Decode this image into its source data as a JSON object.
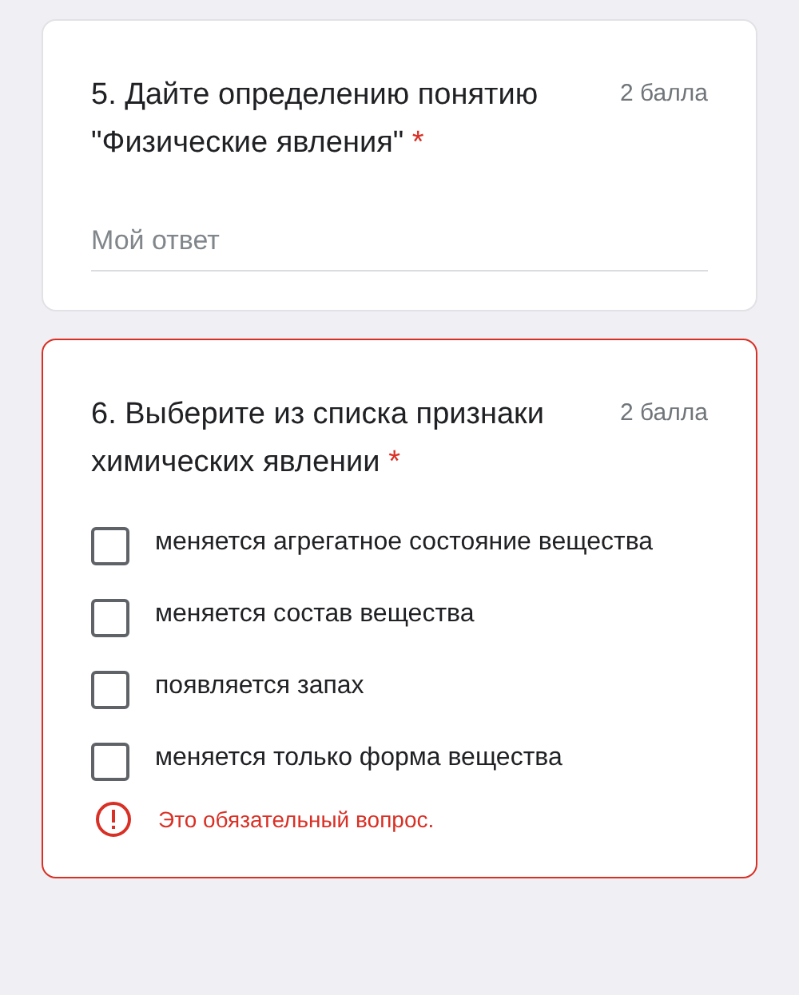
{
  "questions": [
    {
      "kind": "text",
      "title": "5. Дайте определению понятию \"Физические явления\"",
      "required_mark": "*",
      "points": "2 балла",
      "error": false,
      "placeholder": "Мой ответ"
    },
    {
      "kind": "checkboxes",
      "title": "6. Выберите из списка признаки химических явлении",
      "required_mark": "*",
      "points": "2 балла",
      "error": true,
      "options": [
        {
          "label": "меняется агрегатное состояние вещества",
          "checked": false
        },
        {
          "label": "меняется состав вещества",
          "checked": false
        },
        {
          "label": "появляется запах",
          "checked": false
        },
        {
          "label": "меняется только форма вещества",
          "checked": false
        }
      ],
      "error_message": "Это обязательный вопрос."
    }
  ]
}
